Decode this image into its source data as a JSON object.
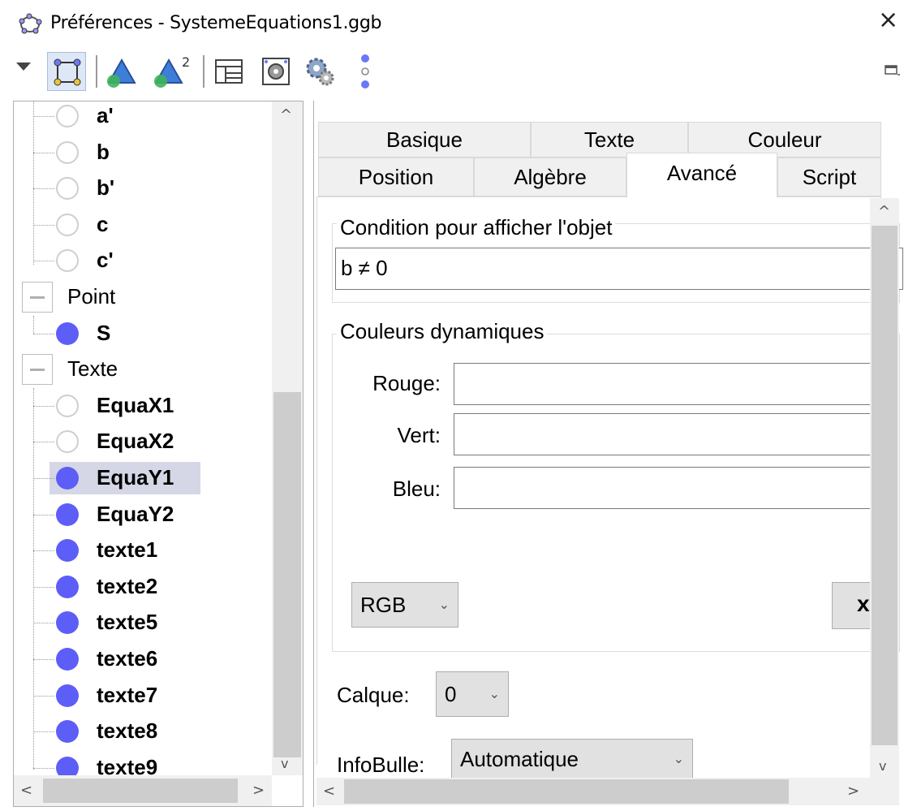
{
  "window": {
    "title": "Préférences - SystemeEquations1.ggb",
    "close_glyph": "×"
  },
  "toolbar": {
    "icons": [
      "menu-dropdown-icon",
      "graphics-view-icon",
      "geometry-3d-icon",
      "geometry-2-icon",
      "layout-icon",
      "graphics-settings-icon",
      "advanced-gear-icon",
      "more-options-icon"
    ],
    "undock_icon": "undock-window-icon"
  },
  "tree": {
    "items": [
      {
        "label": "a'",
        "type": "item",
        "dot": "empty"
      },
      {
        "label": "b",
        "type": "item",
        "dot": "empty"
      },
      {
        "label": "b'",
        "type": "item",
        "dot": "empty"
      },
      {
        "label": "c",
        "type": "item",
        "dot": "empty"
      },
      {
        "label": "c'",
        "type": "item",
        "dot": "empty"
      },
      {
        "label": "Point",
        "type": "group"
      },
      {
        "label": "S",
        "type": "item",
        "dot": "full"
      },
      {
        "label": "Texte",
        "type": "group"
      },
      {
        "label": "EquaX1",
        "type": "item",
        "dot": "empty"
      },
      {
        "label": "EquaX2",
        "type": "item",
        "dot": "empty"
      },
      {
        "label": "EquaY1",
        "type": "item",
        "dot": "full",
        "selected": true
      },
      {
        "label": "EquaY2",
        "type": "item",
        "dot": "full"
      },
      {
        "label": "texte1",
        "type": "item",
        "dot": "full"
      },
      {
        "label": "texte2",
        "type": "item",
        "dot": "full"
      },
      {
        "label": "texte5",
        "type": "item",
        "dot": "full"
      },
      {
        "label": "texte6",
        "type": "item",
        "dot": "full"
      },
      {
        "label": "texte7",
        "type": "item",
        "dot": "full"
      },
      {
        "label": "texte8",
        "type": "item",
        "dot": "full"
      },
      {
        "label": "texte9",
        "type": "item",
        "dot": "full"
      }
    ],
    "dot_color": "#5d5ef8",
    "selected_bg": "#d5d7e6"
  },
  "tabs": {
    "row1": [
      "Basique",
      "Texte",
      "Couleur"
    ],
    "row2": [
      "Position",
      "Algèbre",
      "Avancé",
      "Script"
    ],
    "active": "Avancé"
  },
  "advanced": {
    "condition_legend": "Condition pour afficher l'objet",
    "condition_value": "b ≠ 0",
    "dyn_colors_legend": "Couleurs dynamiques",
    "red_label": "Rouge:",
    "green_label": "Vert:",
    "blue_label": "Bleu:",
    "red_value": "",
    "green_value": "",
    "blue_value": "",
    "color_mode": "RGB",
    "clear_button": "x",
    "layer_label": "Calque:",
    "layer_value": "0",
    "tooltip_label": "InfoBulle:",
    "tooltip_value": "Automatique"
  },
  "scroll": {
    "up": "^",
    "down": "v",
    "left": "<",
    "right": ">"
  }
}
